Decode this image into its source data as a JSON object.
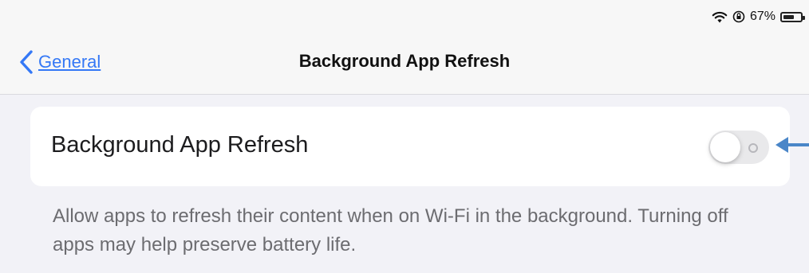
{
  "status_bar": {
    "battery_percent": "67%",
    "battery_level": 0.67,
    "icons": [
      "wifi-icon",
      "orientation-lock-icon",
      "battery-icon"
    ]
  },
  "nav": {
    "back_label": "General",
    "title": "Background App Refresh"
  },
  "setting": {
    "label": "Background App Refresh",
    "enabled": false
  },
  "footer": {
    "text": "Allow apps to refresh their content when on Wi-Fi in the background. Turning off apps may help preserve battery life."
  },
  "colors": {
    "accent": "#3478f6",
    "background": "#f2f2f7",
    "card": "#ffffff",
    "toggle_off": "#e9e9eb",
    "annotation_arrow": "#4a86c8"
  }
}
